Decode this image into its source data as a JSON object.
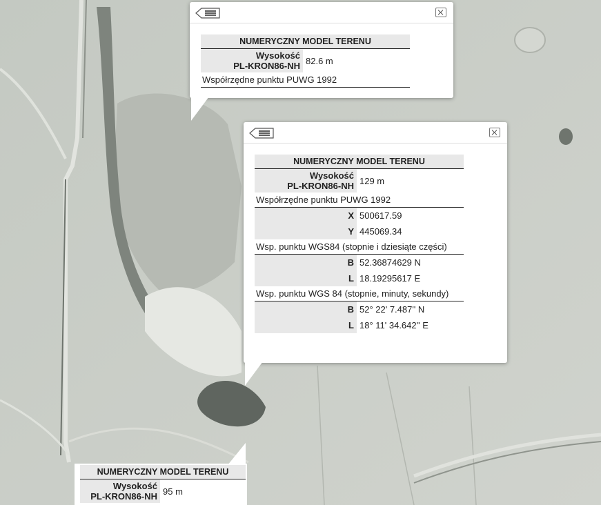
{
  "popups": {
    "top": {
      "title": "NUMERYCZNY MODEL TERENU",
      "height_label_1": "Wysokość",
      "height_label_2": "PL-KRON86-NH",
      "height_value": "82.6 m",
      "coords_section": "Współrzędne punktu PUWG 1992"
    },
    "middle": {
      "title": "NUMERYCZNY MODEL TERENU",
      "height_label_1": "Wysokość",
      "height_label_2": "PL-KRON86-NH",
      "height_value": "129 m",
      "puwg_section": "Współrzędne punktu PUWG 1992",
      "x_label": "X",
      "x_value": "500617.59",
      "y_label": "Y",
      "y_value": "445069.34",
      "wgs_dec_section": "Wsp. punktu WGS84 (stopnie i dziesiąte części)",
      "b_label": "B",
      "b_dec_value": "52.36874629 N",
      "l_label": "L",
      "l_dec_value": "18.19295617 E",
      "wgs_dms_section": "Wsp. punktu WGS 84 (stopnie, minuty, sekundy)",
      "b_dms_value": "52° 22' 7.487'' N",
      "l_dms_value": "18° 11' 34.642'' E"
    },
    "bottom": {
      "title": "NUMERYCZNY MODEL TERENU",
      "height_label_1": "Wysokość",
      "height_label_2": "PL-KRON86-NH",
      "height_value": "95 m"
    }
  },
  "icons": {
    "back": "list-back-icon",
    "close": "close-icon"
  },
  "colors": {
    "map_base": "#c9cdc6",
    "header_cell": "#e8e8e8"
  }
}
